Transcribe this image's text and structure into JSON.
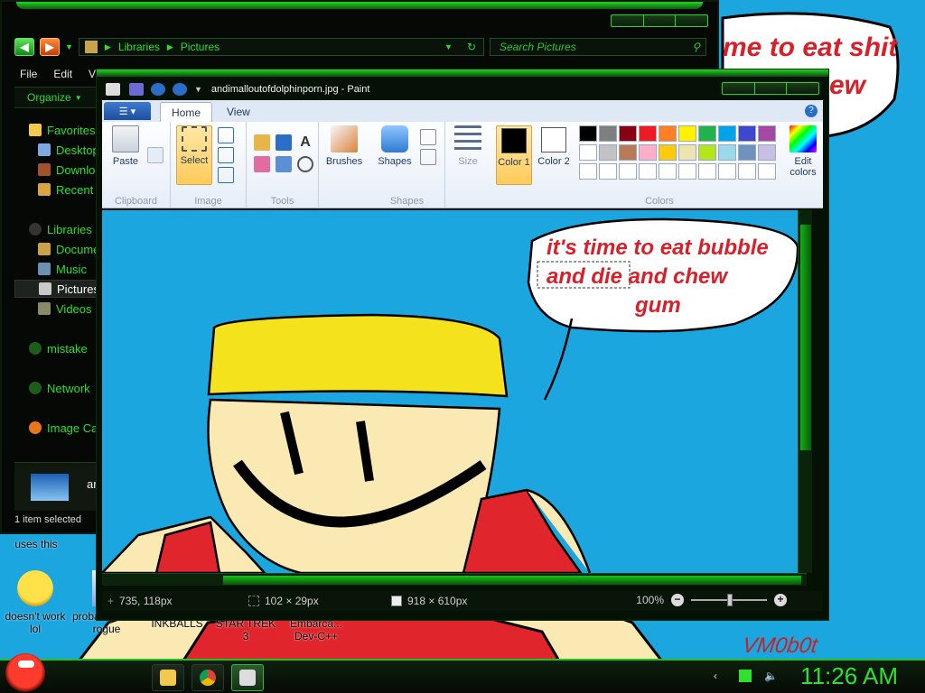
{
  "wallpaper": {
    "bubble_line1": "me to eat shit",
    "bubble_line2": "ew",
    "signature": "VM0b0t"
  },
  "desktop_icons": [
    {
      "id": "uses-this",
      "label": "uses this"
    },
    {
      "id": "yahoo",
      "label": "doesn't work lol",
      "icon": "yahoo-messenger-icon"
    },
    {
      "id": "rogue",
      "label": "probably not a rogue",
      "icon": "document-icon"
    },
    {
      "id": "inkballs",
      "label": "INKBALLS",
      "icon": "game-icon"
    },
    {
      "id": "startrek",
      "label": "STAR TREK 3",
      "icon": "game-icon"
    },
    {
      "id": "devcpp",
      "label": "Embarca... Dev-C++",
      "icon": "ide-icon"
    }
  ],
  "explorer": {
    "breadcrumb": [
      "Libraries",
      "Pictures"
    ],
    "search_placeholder": "Search Pictures",
    "menu": [
      "File",
      "Edit",
      "Vi"
    ],
    "organize": "Organize",
    "nav": [
      {
        "label": "Favorites",
        "type": "top"
      },
      {
        "label": "Desktop",
        "type": "sub"
      },
      {
        "label": "Downloads",
        "type": "sub"
      },
      {
        "label": "Recent Places",
        "type": "sub"
      },
      {
        "label": "Libraries",
        "type": "top"
      },
      {
        "label": "Documents",
        "type": "sub"
      },
      {
        "label": "Music",
        "type": "sub"
      },
      {
        "label": "Pictures",
        "type": "sub"
      },
      {
        "label": "Videos",
        "type": "sub"
      },
      {
        "label": "mistake",
        "type": "top"
      },
      {
        "label": "Network",
        "type": "top"
      },
      {
        "label": "Image Ca",
        "type": "top"
      }
    ],
    "details_name": "ar",
    "status": "1 item selected"
  },
  "paint": {
    "title": "andimalloutofdolphinporn.jpg - Paint",
    "tabs": [
      "Home",
      "View"
    ],
    "groups": {
      "clipboard": "Clipboard",
      "image": "Image",
      "tools": "Tools",
      "shapes": "Shapes",
      "colors": "Colors"
    },
    "buttons": {
      "paste": "Paste",
      "select": "Select",
      "brushes": "Brushes",
      "shapes": "Shapes",
      "size": "Size",
      "color1": "Color 1",
      "color2": "Color 2",
      "edit_colors": "Edit colors"
    },
    "palette": [
      "#000000",
      "#7f7f7f",
      "#880015",
      "#ed1c24",
      "#ff7f27",
      "#fff200",
      "#22b14c",
      "#00a2e8",
      "#3f48cc",
      "#a349a4",
      "#ffffff",
      "#c3c3c3",
      "#b97a57",
      "#ffaec9",
      "#ffc90e",
      "#efe4b0",
      "#b5e61d",
      "#99d9ea",
      "#7092be",
      "#c8bfe7",
      "",
      "",
      "",
      "",
      "",
      "",
      "",
      "",
      "",
      ""
    ],
    "color1": "#000000",
    "color2": "#ffffff",
    "canvas_text": {
      "line1": "it's time to eat bubble",
      "line2": "and die and chew",
      "line3": "gum"
    },
    "status": {
      "cursor": "735, 118px",
      "selection": "102 × 29px",
      "size": "918 × 610px",
      "zoom": "100%"
    }
  },
  "taskbar": {
    "clock": "11:26 AM",
    "apps": [
      "explorer-icon",
      "chrome-icon",
      "paint-icon"
    ]
  }
}
